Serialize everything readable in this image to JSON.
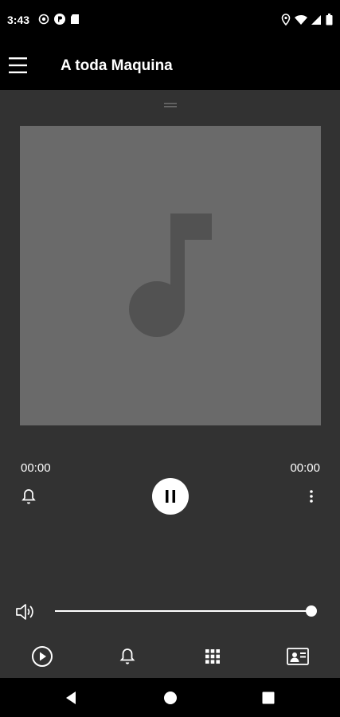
{
  "status_bar": {
    "time": "3:43",
    "left_icons": [
      "play-circle-icon",
      "p-badge-icon",
      "sd-card-icon"
    ],
    "right_icons": [
      "location-icon",
      "wifi-icon",
      "signal-icon",
      "battery-icon"
    ]
  },
  "app_bar": {
    "title": "A toda Maquina",
    "menu_icon": "hamburger-menu-icon"
  },
  "player": {
    "album_art_icon": "music-note-icon",
    "elapsed_time": "00:00",
    "total_time": "00:00",
    "state": "playing",
    "volume_fraction": 1.0
  },
  "bottom_nav": {
    "items": [
      {
        "icon": "play-circle-icon",
        "name": "now-playing"
      },
      {
        "icon": "bell-icon",
        "name": "alarms"
      },
      {
        "icon": "grid-icon",
        "name": "library"
      },
      {
        "icon": "contact-card-icon",
        "name": "profile"
      }
    ]
  },
  "colors": {
    "background": "#323232",
    "album_placeholder": "#6a6a6a",
    "note": "#525252",
    "bars": "#000000",
    "accent": "#ffffff"
  }
}
